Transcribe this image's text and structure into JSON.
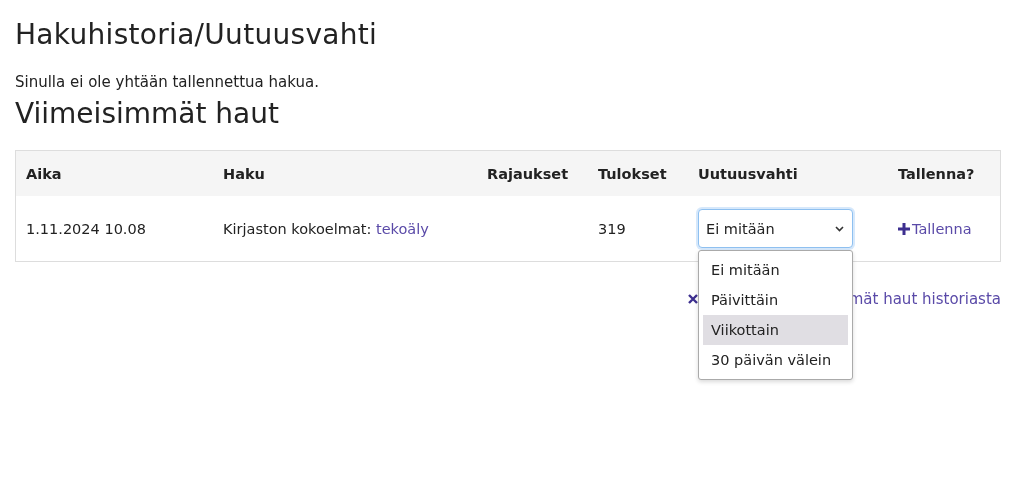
{
  "title": "Hakuhistoria/Uutuusvahti",
  "notice": "Sinulla ei ole yhtään tallennettua hakua.",
  "recent_heading": "Viimeisimmät haut",
  "table": {
    "columns": [
      "Aika",
      "Haku",
      "Rajaukset",
      "Tulokset",
      "Uutuusvahti",
      "Tallenna?"
    ],
    "rows": [
      {
        "time": "1.11.2024 10.08",
        "search_prefix": "Kirjaston kokoelmat:",
        "search_term": "tekoäly",
        "results": "319",
        "alert": {
          "value": "Ei mitään",
          "expanded": true,
          "options": [
            {
              "label": "Ei mitään",
              "highlighted": false
            },
            {
              "label": "Päivittäin",
              "highlighted": false
            },
            {
              "label": "Viikottain",
              "highlighted": true
            },
            {
              "label": "30 päivän välein",
              "highlighted": false
            }
          ]
        },
        "save": "Tallenna"
      }
    ]
  },
  "clear_link": "mät haut historiasta"
}
